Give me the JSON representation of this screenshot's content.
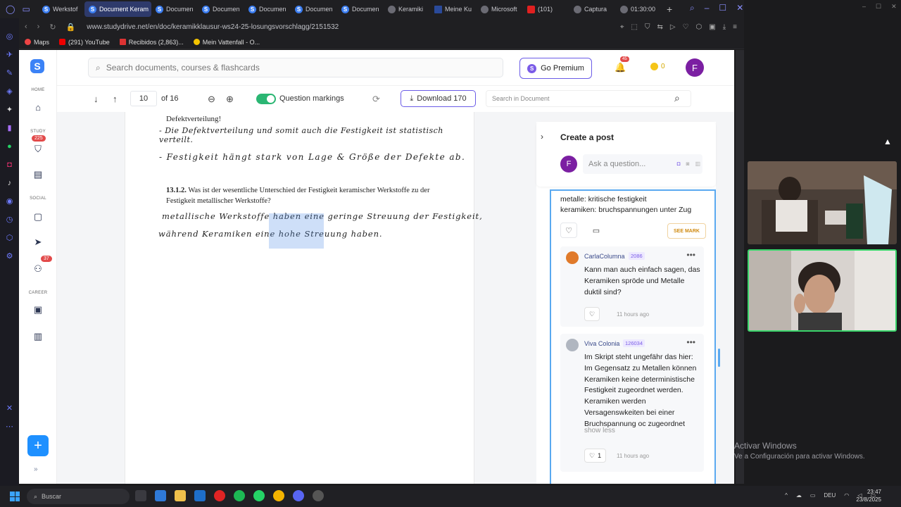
{
  "browser": {
    "tabs": [
      {
        "label": "Werkstof",
        "icon": "S",
        "active": false
      },
      {
        "label": "Document Keram",
        "icon": "S",
        "active": true
      },
      {
        "label": "Documen",
        "icon": "S",
        "active": false
      },
      {
        "label": "Documen",
        "icon": "S",
        "active": false
      },
      {
        "label": "Documen",
        "icon": "S",
        "active": false
      },
      {
        "label": "Documen",
        "icon": "S",
        "active": false
      },
      {
        "label": "Documen",
        "icon": "S",
        "active": false
      },
      {
        "label": "Keramiki",
        "icon": "gray",
        "active": false
      },
      {
        "label": "Meine Ku",
        "icon": "flag",
        "active": false
      },
      {
        "label": "Microsoft",
        "icon": "gray",
        "active": false
      },
      {
        "label": "(101)",
        "icon": "yt",
        "active": false
      },
      {
        "label": "Captura",
        "icon": "gray",
        "active": false
      },
      {
        "label": "01:30:00",
        "icon": "gray",
        "active": false
      }
    ],
    "url": "www.studydrive.net/en/doc/keramikklausur-ws24-25-losungsvorschlagg/2151532",
    "bookmarks": [
      "Maps",
      "(291) YouTube",
      "Recibidos (2,863)...",
      "Mein Vattenfall - O..."
    ]
  },
  "nav": {
    "home": "HOME",
    "study": "STUDY",
    "study_badge": "225",
    "social": "SOCIAL",
    "social_badge": "37",
    "career": "CAREER"
  },
  "header": {
    "search_placeholder": "Search documents, courses & flashcards",
    "premium_label": "Go Premium",
    "bell_badge": "45",
    "coins": "0",
    "avatar": "F"
  },
  "toolbar": {
    "page": "10",
    "page_of": "of 16",
    "question_markings": "Question markings",
    "download": "Download 170",
    "search_placeholder": "Search in Document"
  },
  "document": {
    "line1": "Defektverteilung!",
    "hand1": "- Die Defektverteilung und somit auch die Festigkeit ist statistisch verteilt.",
    "hand2": "- Festigkeit hängt stark von Lage & Größe der Defekte ab.",
    "q_num": "13.1.2.",
    "q_text1": "Was ist der wesentliche Unterschied der Festigkeit keramischer Werkstoffe zu der",
    "q_text2": "Festigkeit metallischer Werkstoffe?",
    "hand3": "metallische Werkstoffe haben eine geringe Streuung der Festigkeit,",
    "hand4": "während Keramiken eine hohe Streuung haben."
  },
  "panel": {
    "create_post": "Create a post",
    "ask_placeholder": "Ask a question...",
    "avatar": "F",
    "answer_line1": "metalle: kritische festigkeit",
    "answer_line2": "keramiken: bruchspannungen unter Zug",
    "see_mark": "SEE MARK",
    "replies": [
      {
        "name": "CarlaColumna",
        "points": "2086",
        "text": "Kann man auch einfach sagen, das Keramiken spröde und Metalle duktil sind?",
        "likes": "",
        "time": "11 hours ago"
      },
      {
        "name": "Viva Colonia",
        "points": "126034",
        "text": "Im Skript steht ungefähr das hier: Im Gegensatz zu Metallen können Keramiken keine deterministische Festigkeit zugeordnet werden. Keramiken werden Versagenswkeiten bei einer Bruchspannung oc zugeordnet",
        "show_less": "show less",
        "likes": "1",
        "time": "11 hours ago"
      }
    ]
  },
  "windows": {
    "activate_title": "Activar Windows",
    "activate_sub": "Ve a Configuración para activar Windows.",
    "search": "Buscar",
    "lang": "DEU",
    "time": "23:47",
    "date": "23/8/2025"
  }
}
